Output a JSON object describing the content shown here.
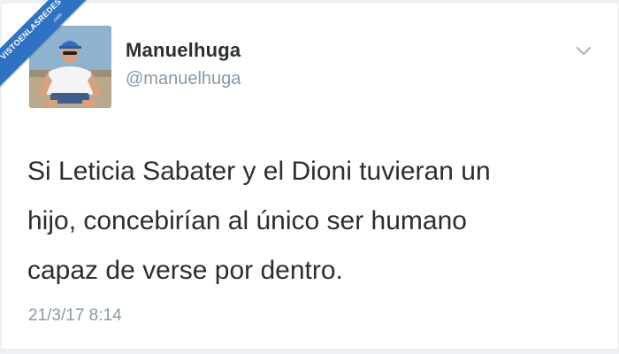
{
  "watermark": {
    "text": "VISTOENLASREDES",
    "suffix": ".com",
    "color": "#2d73c5"
  },
  "tweet": {
    "display_name": "Manuelhuga",
    "handle": "@manuelhuga",
    "text": "Si Leticia Sabater y el Dioni tuvieran un\nhijo, concebirían al único ser humano\ncapaz de verse por dentro.",
    "timestamp": "21/3/17 8:14",
    "menu_icon": "chevron-down-icon"
  },
  "colors": {
    "text_primary": "#292f33",
    "text_secondary": "#8899a6",
    "background": "#ffffff"
  }
}
